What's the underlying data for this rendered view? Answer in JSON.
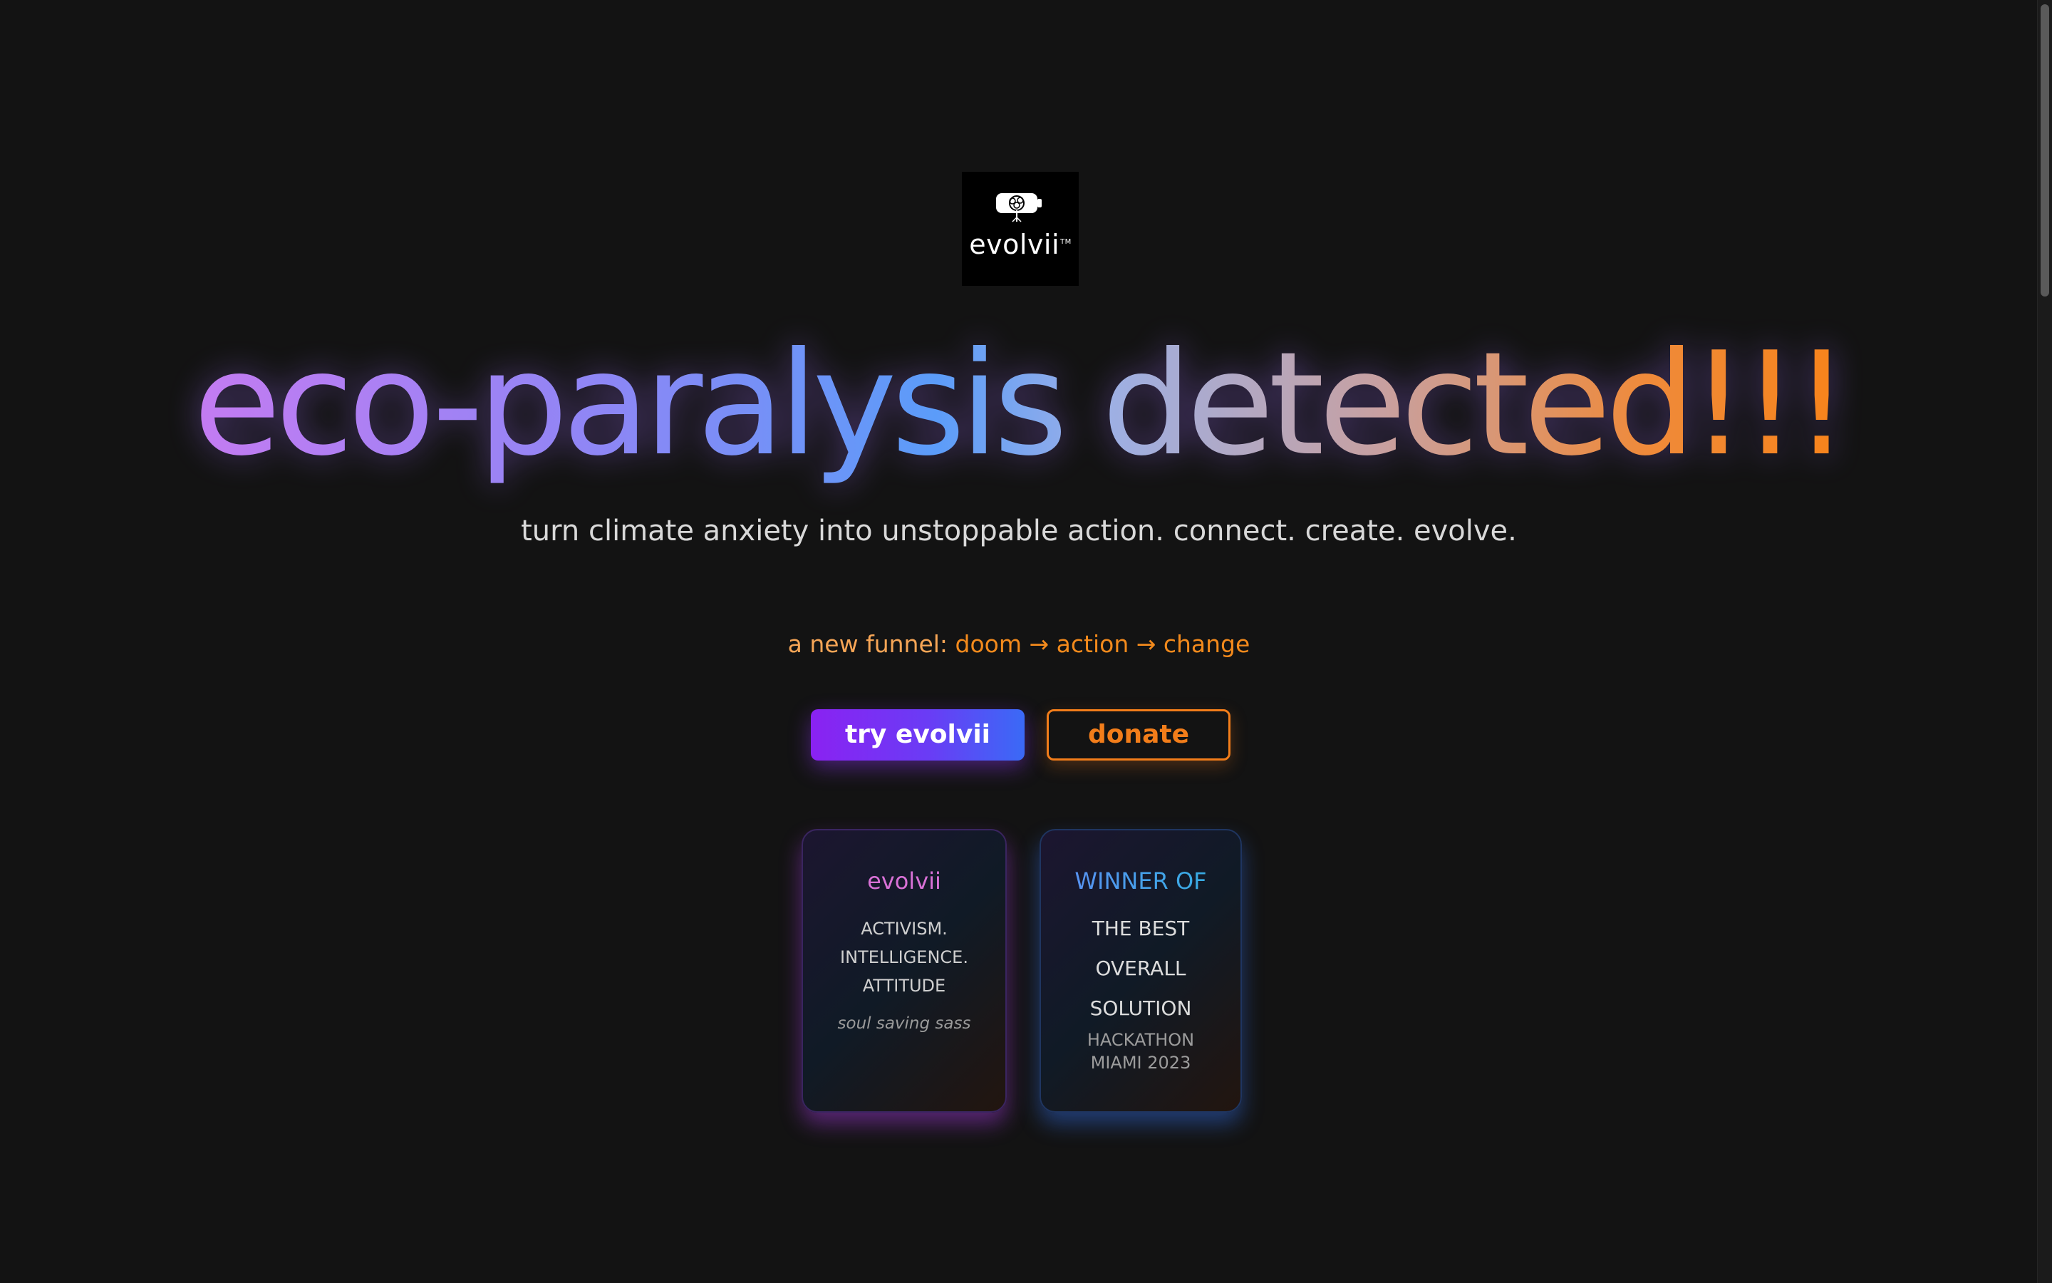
{
  "logo": {
    "text": "evolvii",
    "trademark": "TM",
    "icon": "battery-tree-icon"
  },
  "hero": {
    "headline": "eco-paralysis detected!!!",
    "tagline": "turn climate anxiety into unstoppable action. connect. create. evolve.",
    "funnel_label": "a new funnel:",
    "funnel_steps": "doom → action → change"
  },
  "buttons": {
    "try_label": "try evolvii",
    "donate_label": "donate"
  },
  "cards": {
    "brand": {
      "title": "evolvii",
      "motto": [
        "ACTIVISM.",
        "INTELLIGENCE.",
        "ATTITUDE"
      ],
      "subtitle": "soul saving sass"
    },
    "award": {
      "title": "WINNER OF",
      "award_lines": [
        "THE BEST",
        "OVERALL",
        "SOLUTION"
      ],
      "event_lines": [
        "HACKATHON",
        "MIAMI 2023"
      ]
    }
  },
  "colors": {
    "background": "#131313",
    "accent_purple": "#8a22f2",
    "accent_orange": "#f27d1a",
    "accent_blue": "#3a6af6"
  }
}
